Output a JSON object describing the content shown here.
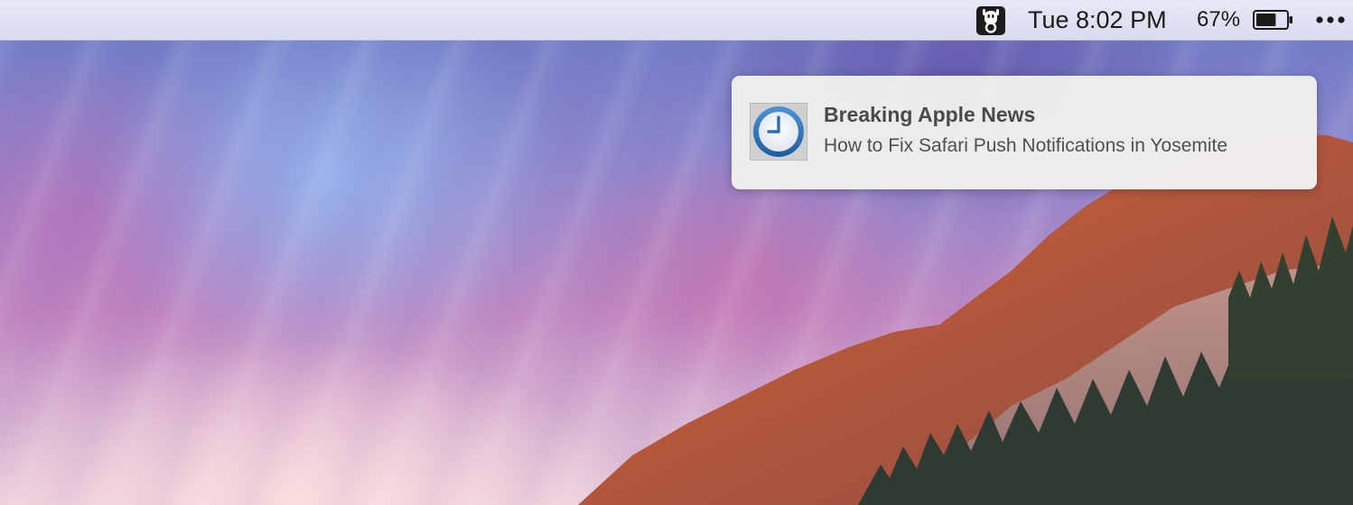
{
  "menubar": {
    "app_icon": "ghost-menu-icon",
    "clock": "Tue 8:02 PM",
    "battery_percent": "67%",
    "battery_level": 0.67,
    "battery_icon": "battery-icon",
    "more_icon": "ellipsis-icon"
  },
  "notification": {
    "icon": "clock-icon",
    "title": "Breaking Apple News",
    "body": "How to Fix Safari Push Notifications in Yosemite"
  },
  "colors": {
    "menubar_bg": "#dfe1f3",
    "notification_bg": "#f0f0f0",
    "clock_icon_blue": "#2a6fb5",
    "mountain_orange": "#c8623c"
  }
}
